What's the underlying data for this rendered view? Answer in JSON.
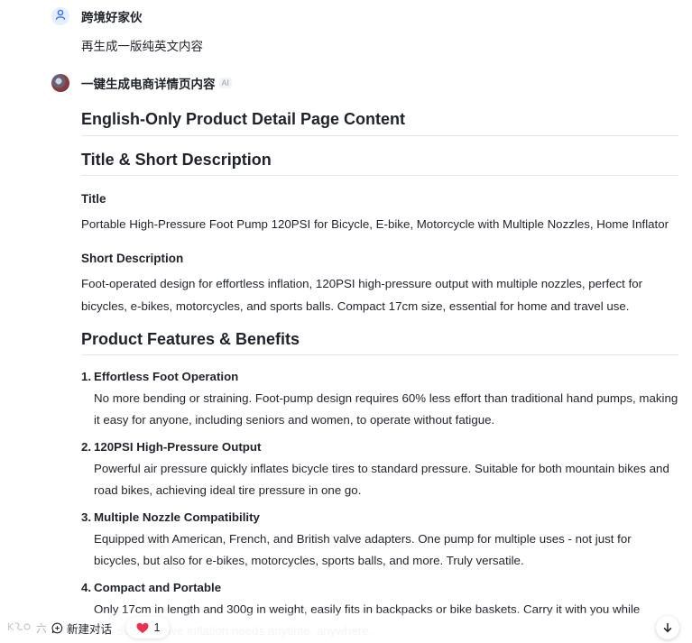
{
  "user_message": {
    "sender": "跨境好家伙",
    "text": "再生成一版纯英文内容"
  },
  "bot_message": {
    "sender": "一键生成电商详情页内容",
    "badge": "AI"
  },
  "content": {
    "heading": "English-Only Product Detail Page Content",
    "section1": {
      "heading": "Title & Short Description",
      "title_label": "Title",
      "title_text": "Portable High-Pressure Foot Pump 120PSI for Bicycle, E-bike, Motorcycle with Multiple Nozzles, Home Inflator",
      "short_label": "Short Description",
      "short_text": "Foot-operated design for effortless inflation, 120PSI high-pressure output with multiple nozzles, perfect for bicycles, e-bikes, motorcycles, and sports balls. Compact 17cm size, essential for home and travel use."
    },
    "section2": {
      "heading": "Product Features & Benefits",
      "items": [
        {
          "num": "1.",
          "title": "Effortless Foot Operation",
          "desc": "No more bending or straining. Foot-pump design requires 60% less effort than traditional hand pumps, making it easy for anyone, including seniors and women, to operate without fatigue."
        },
        {
          "num": "2.",
          "title": "120PSI High-Pressure Output",
          "desc": "Powerful air pressure quickly inflates bicycle tires to standard pressure. Suitable for both mountain bikes and road bikes, achieving ideal tire pressure in one go."
        },
        {
          "num": "3.",
          "title": "Multiple Nozzle Compatibility",
          "desc": "Equipped with American, French, and British valve adapters. One pump for multiple uses - not just for bicycles, but also for e-bikes, motorcycles, sports balls, and more. Truly versatile."
        },
        {
          "num": "4.",
          "title": "Compact and Portable",
          "desc": "Only 17cm in length and 300g in weight, easily fits in backpacks or bike baskets. Carry it with you while traveling to solve inflation needs anytime, anywhere."
        }
      ]
    }
  },
  "bottom_bar": {
    "watermark": "六",
    "new_chat_label": "新建对话",
    "like_count": "1"
  },
  "icons": {
    "user_avatar": "user-icon",
    "new_chat": "chat-plus-icon",
    "like": "heart-icon",
    "scroll": "arrow-down-icon"
  },
  "colors": {
    "accent": "#3370ff",
    "heart": "#e8344e",
    "text": "#1f2329"
  }
}
